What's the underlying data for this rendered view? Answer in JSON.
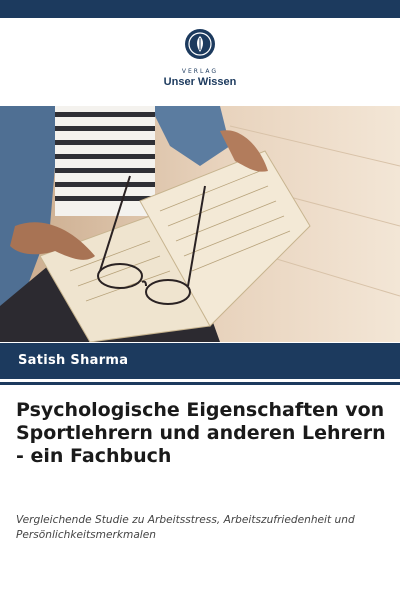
{
  "publisher": {
    "label_top": "VERLAG",
    "name": "Unser Wissen"
  },
  "author": "Satish Sharma",
  "title": "Psychologische Eigenschaften von Sportlehrern und anderen Lehrern - ein Fachbuch",
  "subtitle": "Vergleichende Studie zu Arbeitsstress, Arbeitszufriedenheit und Persönlichkeitsmerkmalen",
  "colors": {
    "brand_navy": "#1c3a5e",
    "background": "#ffffff"
  }
}
